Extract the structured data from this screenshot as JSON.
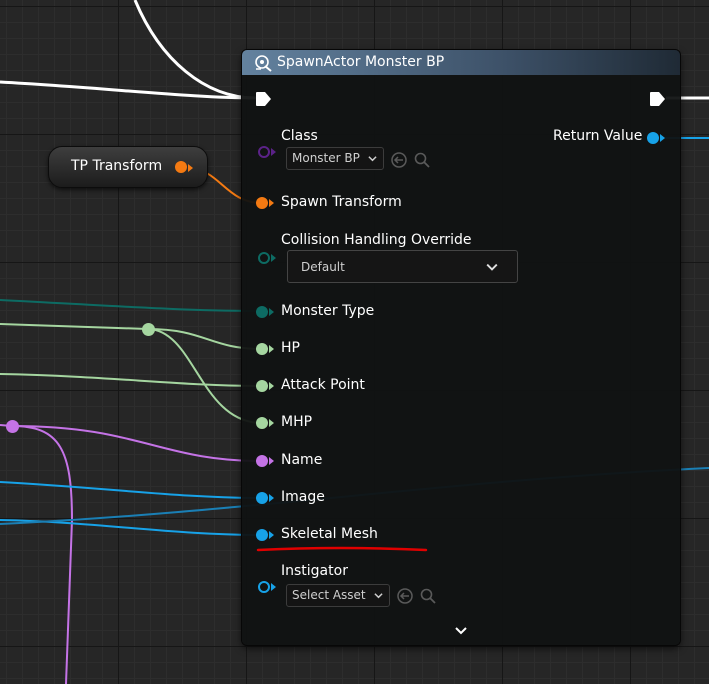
{
  "spawn_node": {
    "title": "SpawnActor Monster BP",
    "header_icon": "spawn-actor-icon",
    "header_color": "#63829f",
    "inputs": [
      {
        "label": "Class",
        "pin_color": "#5b2288",
        "pin_style": "hollow",
        "value": "Monster BP",
        "widget": "class-picker"
      },
      {
        "label": "Spawn Transform",
        "pin_color": "#f47a12",
        "pin_style": "filled"
      },
      {
        "label": "Collision Handling Override",
        "pin_color": "#0d6b63",
        "pin_style": "hollow",
        "value": "Default",
        "widget": "enum-dropdown"
      },
      {
        "label": "Monster Type",
        "pin_color": "#0d6b63",
        "pin_style": "filled"
      },
      {
        "label": "HP",
        "pin_color": "#a5d6a0",
        "pin_style": "filled"
      },
      {
        "label": "Attack Point",
        "pin_color": "#a5d6a0",
        "pin_style": "filled"
      },
      {
        "label": "MHP",
        "pin_color": "#a5d6a0",
        "pin_style": "filled"
      },
      {
        "label": "Name",
        "pin_color": "#c473e6",
        "pin_style": "filled"
      },
      {
        "label": "Image",
        "pin_color": "#17a2e8",
        "pin_style": "filled"
      },
      {
        "label": "Skeletal Mesh",
        "pin_color": "#17a2e8",
        "pin_style": "filled"
      },
      {
        "label": "Instigator",
        "pin_color": "#17a2e8",
        "pin_style": "hollow",
        "value": "Select Asset",
        "widget": "asset-picker"
      }
    ],
    "outputs": [
      {
        "label": "Return Value",
        "pin_color": "#17a2e8"
      }
    ]
  },
  "tp_node": {
    "label": "TP Transform",
    "pin_color": "#f47a12"
  },
  "annotation": {
    "color": "#e00000"
  },
  "icons": {
    "dropdown": "chevron-down-icon",
    "use_selected": "use-selected-arrow-icon",
    "browse": "magnifier-icon",
    "expand": "expand-chevron-icon"
  }
}
